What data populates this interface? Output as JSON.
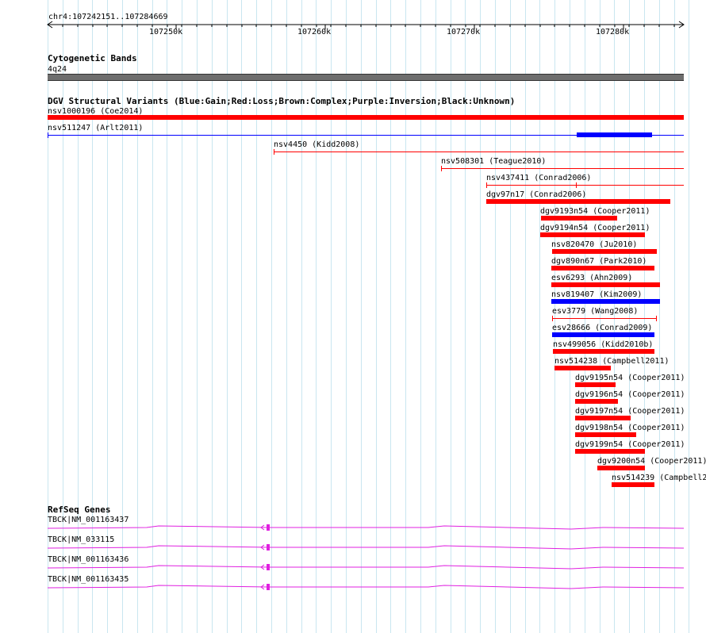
{
  "ruler": {
    "location": "chr4:107242151..107284669",
    "ticks": [
      "107250k",
      "107260k",
      "107270k",
      "107280k"
    ]
  },
  "cytobands": {
    "title": "Cytogenetic Bands",
    "band": "4q24"
  },
  "dgv": {
    "title": "DGV Structural Variants (Blue:Gain;Red:Loss;Brown:Complex;Purple:Inversion;Black:Unknown)",
    "variants": [
      {
        "label": "nsv1000196 (Coe2014)",
        "type": "loss"
      },
      {
        "label": "nsv511247 (Arlt2011)",
        "type": "gain"
      },
      {
        "label": "nsv4450 (Kidd2008)",
        "type": "loss"
      },
      {
        "label": "nsv508301 (Teague2010)",
        "type": "loss"
      },
      {
        "label": "nsv437411 (Conrad2006)",
        "type": "loss"
      },
      {
        "label": "dgv97n17 (Conrad2006)",
        "type": "loss"
      },
      {
        "label": "dgv9193n54 (Cooper2011)",
        "type": "loss"
      },
      {
        "label": "dgv9194n54 (Cooper2011)",
        "type": "loss"
      },
      {
        "label": "nsv820470 (Ju2010)",
        "type": "loss"
      },
      {
        "label": "dgv890n67 (Park2010)",
        "type": "loss"
      },
      {
        "label": "esv6293 (Ahn2009)",
        "type": "loss"
      },
      {
        "label": "nsv819407 (Kim2009)",
        "type": "gain"
      },
      {
        "label": "esv3779 (Wang2008)",
        "type": "loss"
      },
      {
        "label": "esv28666 (Conrad2009)",
        "type": "gain"
      },
      {
        "label": "nsv499056 (Kidd2010b)",
        "type": "loss"
      },
      {
        "label": "nsv514238 (Campbell2011)",
        "type": "loss"
      },
      {
        "label": "dgv9195n54 (Cooper2011)",
        "type": "loss"
      },
      {
        "label": "dgv9196n54 (Cooper2011)",
        "type": "loss"
      },
      {
        "label": "dgv9197n54 (Cooper2011)",
        "type": "loss"
      },
      {
        "label": "dgv9198n54 (Cooper2011)",
        "type": "loss"
      },
      {
        "label": "dgv9199n54 (Cooper2011)",
        "type": "loss"
      },
      {
        "label": "dgv9200n54 (Cooper2011)",
        "type": "loss"
      },
      {
        "label": "nsv514239 (Campbell2",
        "type": "loss"
      }
    ]
  },
  "refseq": {
    "title": "RefSeq Genes",
    "genes": [
      {
        "label": "TBCK|NM_001163437"
      },
      {
        "label": "TBCK|NM_033115"
      },
      {
        "label": "TBCK|NM_001163436"
      },
      {
        "label": "TBCK|NM_001163435"
      }
    ]
  },
  "colors": {
    "loss": "#ff0000",
    "gain": "#0000ff",
    "gene": "#e020e0",
    "band": "#6e6e6e",
    "grid": "#c9e6f0"
  }
}
